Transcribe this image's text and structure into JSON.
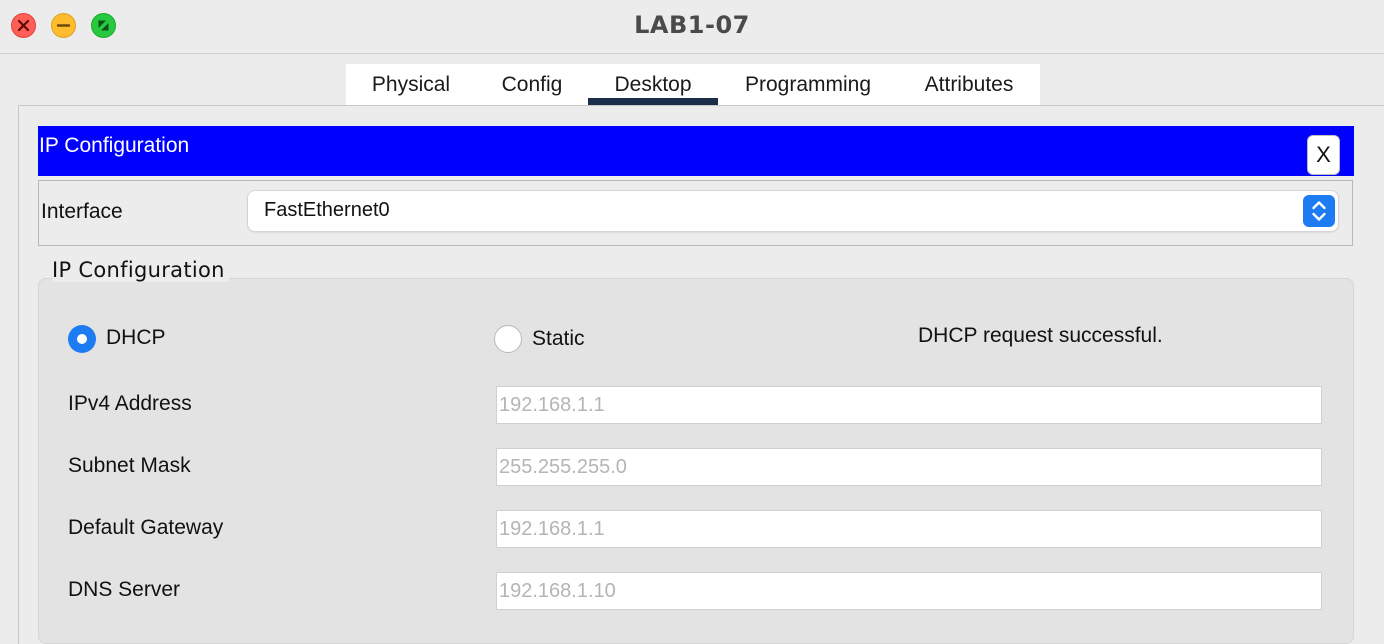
{
  "window": {
    "title": "LAB1-07",
    "controls": {
      "close": "close-icon",
      "minimize": "minimize-icon",
      "maximize": "maximize-icon"
    },
    "colors": {
      "close": "#ff5f57",
      "minimize": "#febc2e",
      "maximize": "#28c840"
    }
  },
  "tabs": [
    {
      "label": "Physical",
      "active": false
    },
    {
      "label": "Config",
      "active": false
    },
    {
      "label": "Desktop",
      "active": true
    },
    {
      "label": "Programming",
      "active": false
    },
    {
      "label": "Attributes",
      "active": false
    }
  ],
  "panel": {
    "title": "IP Configuration",
    "close_label": "X",
    "header_color": "#0000ff"
  },
  "interface": {
    "label": "Interface",
    "selected": "FastEthernet0",
    "dropdown_icon": "chevron-updown-icon"
  },
  "ip_config": {
    "legend": "IP Configuration",
    "mode_dhcp": "DHCP",
    "mode_static": "Static",
    "selected_mode": "DHCP",
    "status": "DHCP request successful.",
    "fields": [
      {
        "label": "IPv4 Address",
        "value": "192.168.1.1"
      },
      {
        "label": "Subnet Mask",
        "value": "255.255.255.0"
      },
      {
        "label": "Default Gateway",
        "value": "192.168.1.1"
      },
      {
        "label": "DNS Server",
        "value": "192.168.1.10"
      }
    ]
  }
}
